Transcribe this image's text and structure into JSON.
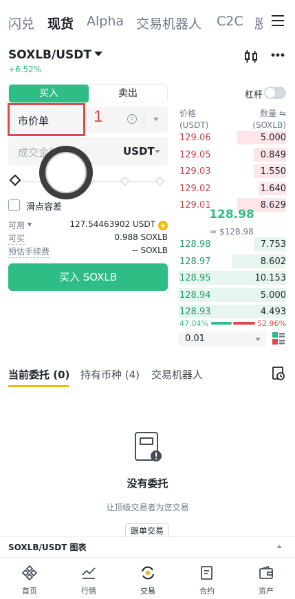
{
  "top_tabs": [
    "闪兑",
    "现货",
    "Alpha",
    "交易机器人",
    "C2C",
    "股"
  ],
  "pair": {
    "name": "SOXLB/USDT",
    "change": "+6.52%"
  },
  "order": {
    "buy_label": "买入",
    "sell_label": "卖出",
    "leverage_label": "杠杆",
    "order_type": "市价单",
    "annotation_number": "1",
    "amount_placeholder": "成交金额",
    "amount_unit": "USDT",
    "slippage_label": "滑点容差",
    "available_label": "可用",
    "available_value": "127.54463902 USDT",
    "can_buy_label": "可买",
    "can_buy_value": "0.988 SOXLB",
    "fee_label": "预估手续费",
    "fee_value": "-- SOXLB",
    "submit_label": "买入 SOXLB"
  },
  "orderbook": {
    "price_header": "价格",
    "price_unit": "(USDT)",
    "qty_header": "数量",
    "qty_unit": "(SOXLB)",
    "asks": [
      {
        "price": "129.06",
        "qty": "5.000",
        "depth": 0.45
      },
      {
        "price": "129.05",
        "qty": "0.849",
        "depth": 0.3
      },
      {
        "price": "129.03",
        "qty": "1.550",
        "depth": 0.3
      },
      {
        "price": "129.02",
        "qty": "1.640",
        "depth": 0.25
      },
      {
        "price": "129.01",
        "qty": "8.629",
        "depth": 0.45
      }
    ],
    "mid_price": "128.98",
    "mid_fiat": "≈ $128.98",
    "bids": [
      {
        "price": "128.98",
        "qty": "7.753",
        "depth": 0.3
      },
      {
        "price": "128.97",
        "qty": "8.602",
        "depth": 0.5
      },
      {
        "price": "128.95",
        "qty": "10.153",
        "depth": 0.99
      },
      {
        "price": "128.94",
        "qty": "5.000",
        "depth": 0.99
      },
      {
        "price": "128.93",
        "qty": "4.493",
        "depth": 0.99
      }
    ],
    "buy_ratio": "47.04%",
    "sell_ratio": "52.96%",
    "precision": "0.01"
  },
  "lower_tabs": {
    "open_orders": "当前委托 (0)",
    "holdings": "持有币种 (4)",
    "bots": "交易机器人"
  },
  "empty": {
    "title": "没有委托",
    "subtitle": "让顶级交易者为您交易",
    "button": "跟单交易"
  },
  "chart_bar_label": "SOXLB/USDT 图表",
  "nav": [
    "首页",
    "行情",
    "交易",
    "合约",
    "资产"
  ],
  "colors": {
    "green": "#2ebd85",
    "red": "#e04848",
    "accent": "#f0b90b"
  }
}
